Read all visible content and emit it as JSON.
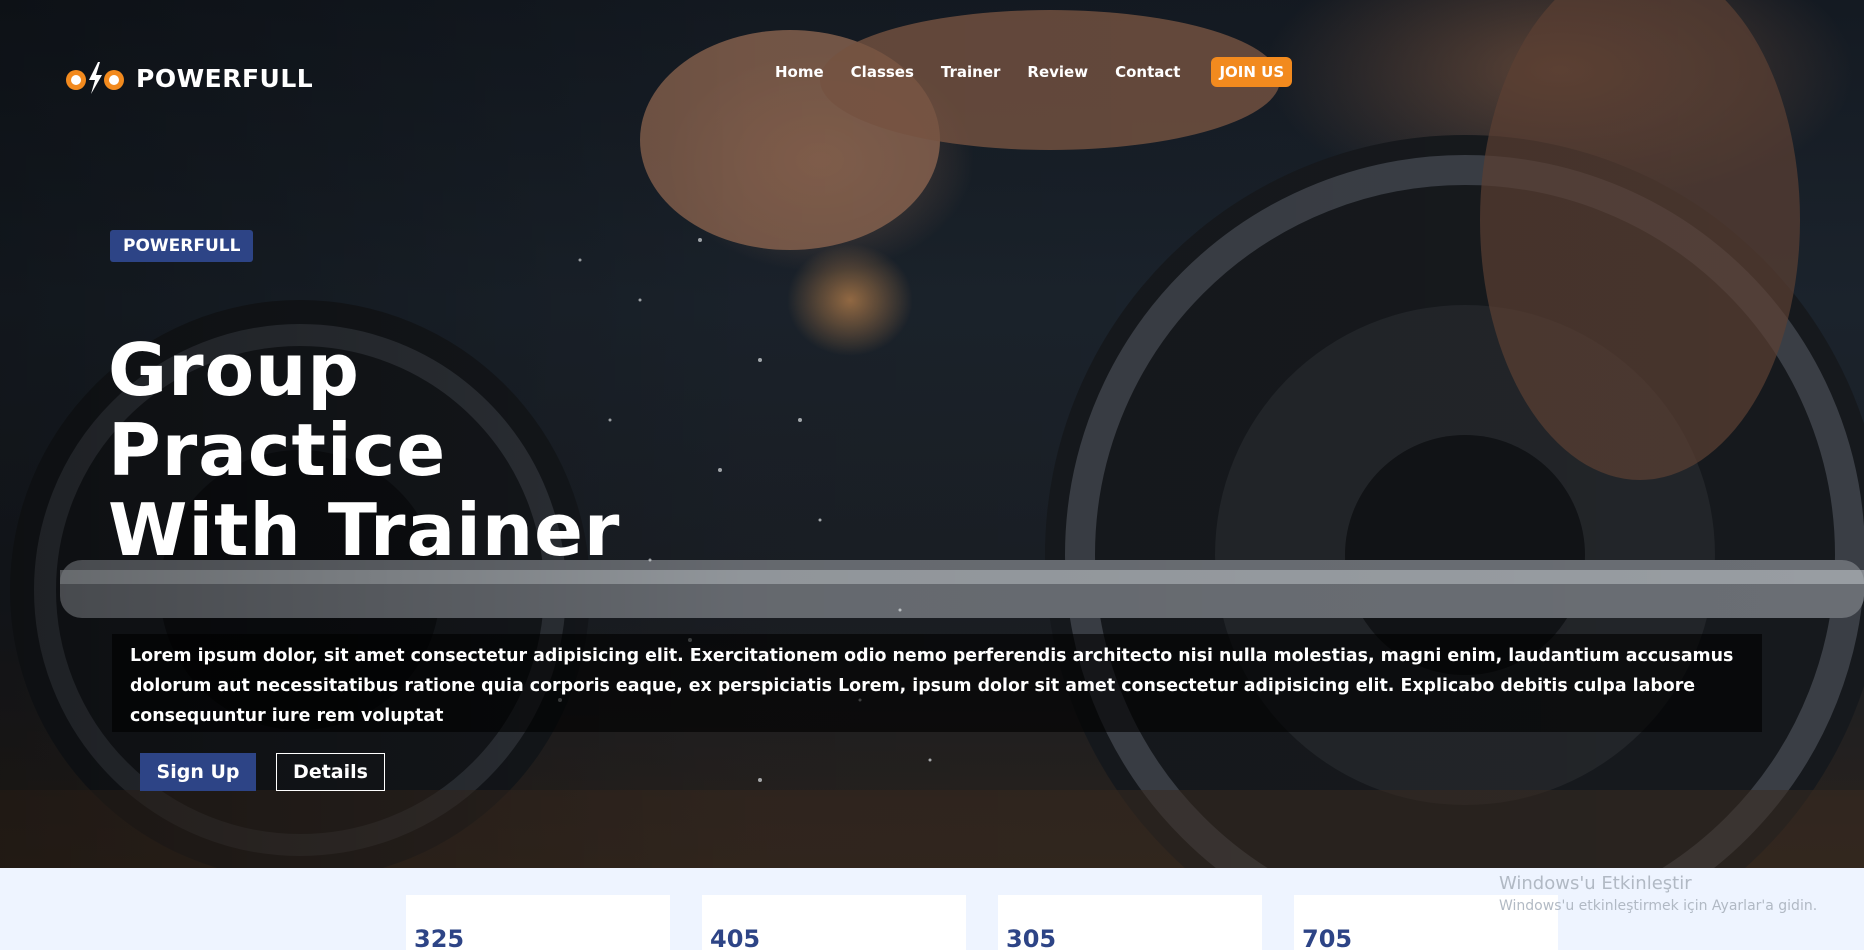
{
  "brand": {
    "name": "POWERFULL",
    "accent": "#f28a1e",
    "primary": "#2d4486"
  },
  "nav": {
    "items": [
      "Home",
      "Classes",
      "Trainer",
      "Review",
      "Contact"
    ],
    "join_label": "JOIN US"
  },
  "hero": {
    "badge": "POWERFULL",
    "headline": [
      "Group",
      "Practice",
      "With Trainer"
    ],
    "description": "Lorem ipsum dolor, sit amet consectetur adipisicing elit. Exercitationem odio nemo perferendis architecto nisi nulla molestias, magni enim, laudantium accusamus dolorum aut necessitatibus ratione quia corporis eaque, ex perspiciatis Lorem, ipsum dolor sit amet consectetur adipisicing elit. Explicabo debitis culpa labore consequuntur iure rem voluptat",
    "signup_label": "Sign Up",
    "details_label": "Details"
  },
  "stats": [
    "325",
    "405",
    "305",
    "705"
  ],
  "watermark": {
    "title": "Windows'u Etkinleştir",
    "subtitle": "Windows'u etkinleştirmek için Ayarlar'a gidin."
  }
}
